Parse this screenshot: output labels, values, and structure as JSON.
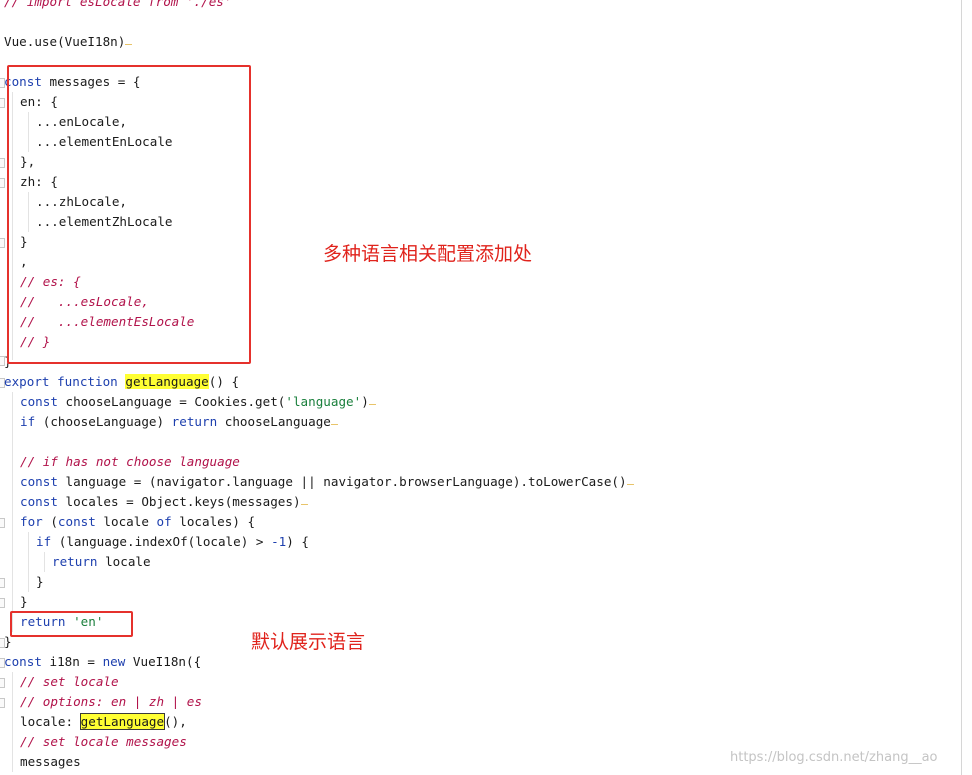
{
  "code": {
    "l1_comment": "// import esLocale from './es'",
    "l2_a": "Vue.use(VueI18n)",
    "l3_kw": "const",
    "l3_rest": " messages = {",
    "l4": "en: {",
    "l5": "...enLocale,",
    "l6": "...elementEnLocale",
    "l7": "},",
    "l8": "zh: {",
    "l9": "...zhLocale,",
    "l10": "...elementZhLocale",
    "l11": "}",
    "l12": ",",
    "l13": "// es: {",
    "l14": "//   ...esLocale,",
    "l15": "//   ...elementEsLocale",
    "l16": "// }",
    "l17": "}",
    "l18_kw1": "export",
    "l18_kw2": "function",
    "l18_fn": "getLanguage",
    "l18_rest": "() {",
    "l19_kw": "const",
    "l19_a": " chooseLanguage = Cookies.get(",
    "l19_str": "'language'",
    "l19_b": ")",
    "l20_kw1": "if",
    "l20_a": " (chooseLanguage) ",
    "l20_kw2": "return",
    "l20_b": " chooseLanguage",
    "l21_comment": "// if has not choose language",
    "l22_kw": "const",
    "l22_rest": " language = (navigator.language || navigator.browserLanguage).toLowerCase()",
    "l23_kw": "const",
    "l23_rest": " locales = Object.keys(messages)",
    "l24_kw1": "for",
    "l24_a": " (",
    "l24_kw2": "const",
    "l24_b": " locale ",
    "l24_kw3": "of",
    "l24_c": " locales) {",
    "l25_kw": "if",
    "l25_a": " (language.indexOf(locale) > ",
    "l25_num": "-1",
    "l25_b": ") {",
    "l26_kw": "return",
    "l26_rest": " locale",
    "l27": "}",
    "l28": "}",
    "l29_kw": "return",
    "l29_str": "'en'",
    "l30": "}",
    "l31_kw1": "const",
    "l31_a": " i18n = ",
    "l31_kw2": "new",
    "l31_b": " VueI18n({",
    "l32_comment": "// set locale",
    "l33_comment": "// options: en | zh | es",
    "l34_a": "locale: ",
    "l34_fn": "getLanguage",
    "l34_b": "(),",
    "l35_comment": "// set locale messages",
    "l36": "messages"
  },
  "annotations": {
    "config_note": "多种语言相关配置添加处",
    "default_note": "默认展示语言"
  },
  "watermark": "https://blog.csdn.net/zhang__ao",
  "colors": {
    "keyword": "#1d3fae",
    "string": "#1a7f3c",
    "comment": "#b1124a",
    "highlight": "#ffff33",
    "annotation": "#e0231c"
  }
}
